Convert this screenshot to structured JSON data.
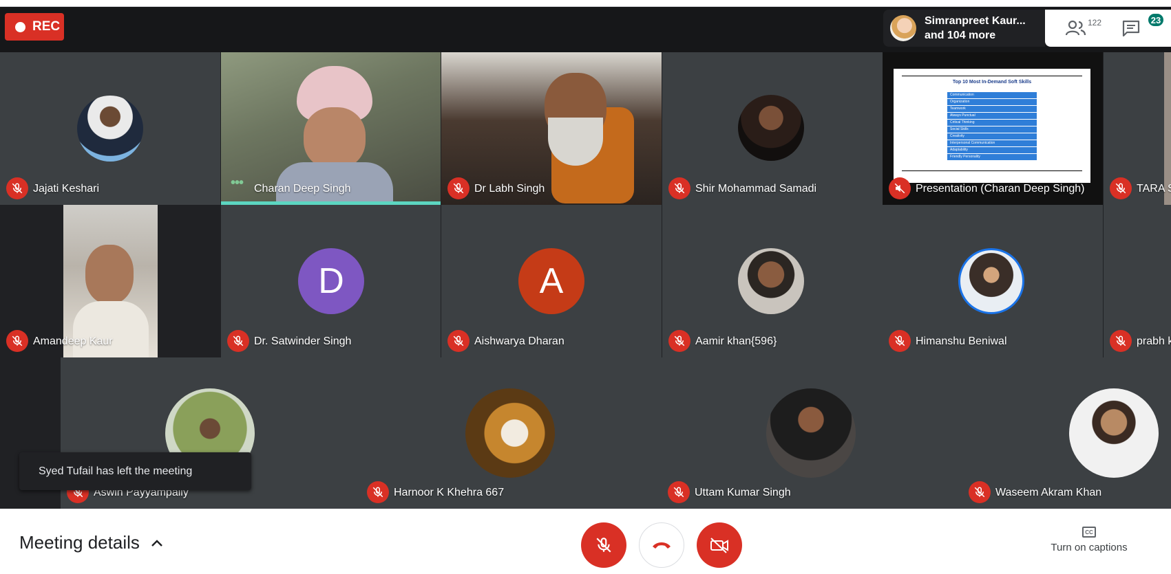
{
  "recording": {
    "label": "REC"
  },
  "presenter": {
    "line1": "Simranpreet Kaur...",
    "line2": "and 104 more"
  },
  "people_count": "122",
  "chat_count": "23",
  "participants": [
    {
      "name": "Jajati Keshari"
    },
    {
      "name": "Charan Deep Singh"
    },
    {
      "name": "Dr Labh Singh"
    },
    {
      "name": "Shir Mohammad Samadi"
    },
    {
      "name": "Presentation (Charan Deep Singh)"
    },
    {
      "name": "TARA S"
    },
    {
      "name": "Amandeep Kaur"
    },
    {
      "name": "Dr. Satwinder Singh",
      "initial": "D"
    },
    {
      "name": "Aishwarya Dharan",
      "initial": "A"
    },
    {
      "name": "Aamir khan{596}"
    },
    {
      "name": "Himanshu Beniwal"
    },
    {
      "name": "prabh k"
    },
    {
      "name": "Aswin Payyampally"
    },
    {
      "name": "Harnoor K Khehra 667"
    },
    {
      "name": "Uttam Kumar Singh"
    },
    {
      "name": "Waseem Akram Khan"
    }
  ],
  "slide": {
    "title": "Top 10 Most In-Demand Soft Skills",
    "rows": [
      "Communication",
      "Organization",
      "Teamwork",
      "Always Punctual",
      "Critical Thinking",
      "Social Skills",
      "Creativity",
      "Interpersonal Communication",
      "Adaptability",
      "Friendly Personality"
    ]
  },
  "toast": "Syed Tufail has left the meeting",
  "bottom": {
    "meeting_details": "Meeting details",
    "captions": "Turn on captions",
    "cc": "CC"
  },
  "colors": {
    "accent_red": "#d93025",
    "active_speaker": "#5cd6c1",
    "chat_badge": "#00796b",
    "stage": "#202124"
  }
}
